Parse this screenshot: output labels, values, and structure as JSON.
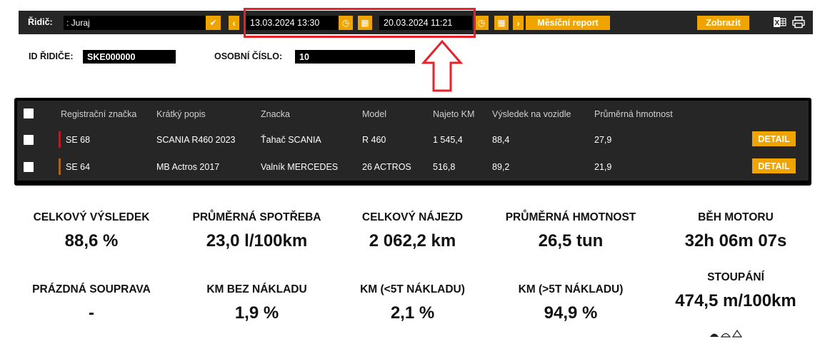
{
  "toolbar": {
    "driver_label": "Řidič:",
    "driver_value": ": Juraj",
    "chevron_down": "✔",
    "chevron_left": "‹",
    "date_from": "13.03.2024 13:30",
    "date_to": "20.03.2024 11:21",
    "clock_glyph": "◷",
    "calendar_glyph": "▦",
    "chevron_right": "›",
    "monthly_report_label": "Měsíční report",
    "show_label": "Zobrazit"
  },
  "driver_info": {
    "id_label": "ID ŘIDIČE:",
    "id_value": "SKE000000",
    "personal_number_label": "OSOBNÍ ČÍSLO:",
    "personal_number_value": "10"
  },
  "vehicle_table": {
    "columns": [
      "Registrační značka",
      "Krátký popis",
      "Znacka",
      "Model",
      "Najeto KM",
      "Výsledek na vozidle",
      "Průměrná hmotnost"
    ],
    "rows": [
      {
        "reg": "SE 68",
        "short": "SCANIA R460 2023",
        "brand": "Ťahač SCANIA",
        "model": "R 460",
        "km": "1 545,4",
        "result": "88,4",
        "weight": "27,9",
        "detail": "DETAIL",
        "color": "#b3202a"
      },
      {
        "reg": "SE 64",
        "short": "MB Actros 2017",
        "brand": "Valník MERCEDES",
        "model": "26 ACTROS",
        "km": "516,8",
        "result": "89,2",
        "weight": "21,9",
        "detail": "DETAIL",
        "color": "#a8641c"
      }
    ]
  },
  "kpis": [
    {
      "label": "CELKOVÝ VÝSLEDEK",
      "value": "88,6 %"
    },
    {
      "label": "PRŮMĚRNÁ SPOTŘEBA",
      "value": "23,0 l/100km"
    },
    {
      "label": "CELKOVÝ NÁJEZD",
      "value": "2 062,2 km"
    },
    {
      "label": "PRŮMĚRNÁ HMOTNOST",
      "value": "26,5 tun"
    },
    {
      "label": "BĚH MOTORU",
      "value": "32h 06m 07s"
    },
    {
      "label": "PRÁZDNÁ SOUPRAVA",
      "value": "-"
    },
    {
      "label": "KM BEZ NÁKLADU",
      "value": "1,9 %"
    },
    {
      "label": "KM (<5T NÁKLADU)",
      "value": "2,1 %"
    },
    {
      "label": "KM (>5T NÁKLADU)",
      "value": "94,9 %"
    },
    {
      "label": "STOUPÁNÍ",
      "value": "474,5 m/100km"
    }
  ],
  "colors": {
    "accent": "#f0a400",
    "highlight": "#e8202a",
    "toolbar_bg": "#262626"
  },
  "icons": [
    "clock-icon",
    "calendar-icon",
    "excel-icon",
    "print-icon",
    "arrow-up-icon"
  ]
}
